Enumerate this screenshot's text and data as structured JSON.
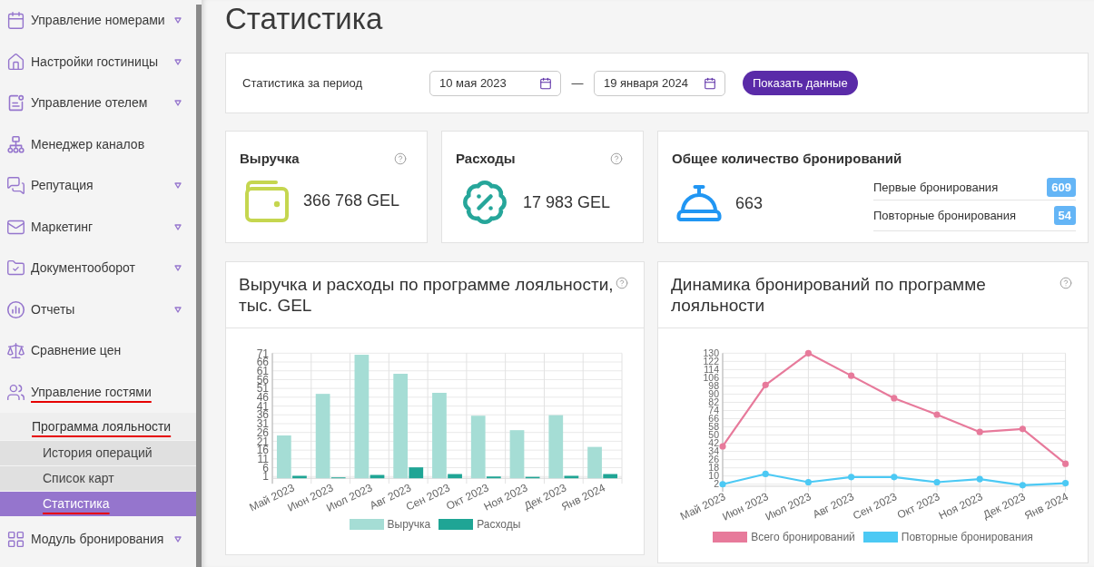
{
  "sidebar": {
    "items": [
      {
        "label": "Управление номерами",
        "caret": true,
        "underlined": false
      },
      {
        "label": "Настройки гостиницы",
        "caret": true,
        "underlined": false
      },
      {
        "label": "Управление отелем",
        "caret": true,
        "underlined": false
      },
      {
        "label": "Менеджер каналов",
        "caret": false,
        "underlined": false
      },
      {
        "label": "Репутация",
        "caret": true,
        "underlined": false
      },
      {
        "label": "Маркетинг",
        "caret": true,
        "underlined": false
      },
      {
        "label": "Документооборот",
        "caret": true,
        "underlined": false
      },
      {
        "label": "Отчеты",
        "caret": true,
        "underlined": false
      },
      {
        "label": "Сравнение цен",
        "caret": false,
        "underlined": false
      },
      {
        "label": "Управление гостями",
        "caret": false,
        "underlined": true,
        "children": [
          {
            "label": "Программа лояльности",
            "underlined": true,
            "children": [
              {
                "label": "История операций",
                "selected": false,
                "underlined": false
              },
              {
                "label": "Список карт",
                "selected": false,
                "underlined": false
              },
              {
                "label": "Статистика",
                "selected": true,
                "underlined": true
              }
            ]
          }
        ]
      },
      {
        "label": "Модуль бронирования",
        "caret": true,
        "underlined": false
      }
    ]
  },
  "page_title": "Статистика",
  "period": {
    "label": "Статистика за период",
    "date_from": "10 мая 2023",
    "separator": "—",
    "date_to": "19 января 2024",
    "submit_button": "Показать данные"
  },
  "kpis": [
    {
      "title": "Выручка",
      "value": "366 768 GEL",
      "color": "#c5d64f"
    },
    {
      "title": "Расходы",
      "value": "17 983 GEL",
      "color": "#26a69a"
    }
  ],
  "bookings": {
    "title": "Общее количество бронирований",
    "value": "663",
    "breakdown": [
      {
        "label": "Первые бронирования",
        "count": "609"
      },
      {
        "label": "Повторные бронирования",
        "count": "54"
      }
    ]
  },
  "charts": [
    {
      "chart_data": {
        "type": "bar",
        "title": "Выручка и расходы по программе лояльности, тыс. GEL",
        "categories": [
          "Май 2023",
          "Июн 2023",
          "Июл 2023",
          "Авг 2023",
          "Сен 2023",
          "Окт 2023",
          "Ноя 2023",
          "Дек 2023",
          "Янв 2024"
        ],
        "series": [
          {
            "name": "Выручка",
            "color": "#a5ddd5",
            "values": [
              24.3,
              47.9,
              70.1,
              59.3,
              48.5,
              35.5,
              27.3,
              35.8,
              17.8
            ]
          },
          {
            "name": "Расходы",
            "color": "#1fa595",
            "values": [
              1.4,
              0.5,
              1.9,
              6.2,
              2.4,
              1,
              0.8,
              1.4,
              2.4
            ]
          }
        ],
        "ylim": [
          0,
          71
        ],
        "yticks": [
          1,
          6,
          11,
          16,
          21,
          26,
          31,
          36,
          41,
          46,
          51,
          56,
          61,
          66,
          71
        ],
        "grid": true,
        "legend": true
      }
    },
    {
      "chart_data": {
        "type": "line",
        "title": "Динамика бронирований по программе лояльности",
        "categories": [
          "Май 2023",
          "Июн 2023",
          "Июл 2023",
          "Авг 2023",
          "Сен 2023",
          "Окт 2023",
          "Ноя 2023",
          "Дек 2023",
          "Янв 2024"
        ],
        "series": [
          {
            "name": "Всего бронирований",
            "color": "#e77a9b",
            "marker": "circle",
            "values": [
              39,
              99,
              130,
              108,
              86,
              70,
              53,
              56,
              22
            ]
          },
          {
            "name": "Повторные бронирования",
            "color": "#4cc9f4",
            "marker": "circle",
            "values": [
              2,
              12,
              4,
              9,
              9,
              4,
              7,
              1,
              3
            ]
          }
        ],
        "ylim": [
          0,
          130
        ],
        "yticks": [
          2,
          10,
          18,
          26,
          34,
          42,
          50,
          58,
          66,
          74,
          82,
          90,
          98,
          106,
          114,
          122,
          130
        ],
        "grid": true,
        "legend": true
      }
    }
  ]
}
